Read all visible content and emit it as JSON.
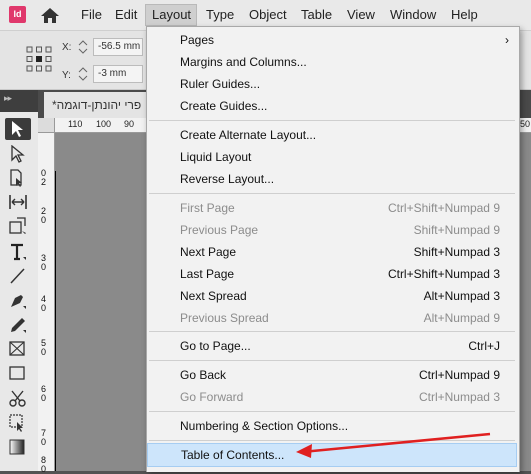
{
  "app": {
    "logo_text": "Id"
  },
  "menubar": {
    "items": [
      "File",
      "Edit",
      "Layout",
      "Type",
      "Object",
      "Table",
      "View",
      "Window",
      "Help"
    ],
    "active": "Layout"
  },
  "control_panel": {
    "x_label": "X:",
    "x_value": "-56.5 mm",
    "y_label": "Y:",
    "y_value": "-3 mm"
  },
  "tools_panel": {
    "collapse_glyph": "▸▸"
  },
  "document": {
    "tab_title": "פרי יהונתן-דוגמה*",
    "ruler_h": [
      "110",
      "100",
      "90",
      "50"
    ],
    "ruler_v": [
      "0\n2",
      "2\n0",
      "3\n0",
      "4\n0",
      "5\n0",
      "6\n0",
      "7\n0",
      "8\n0"
    ]
  },
  "layout_menu": {
    "items": [
      {
        "label": "Pages",
        "shortcut": "",
        "submenu": true,
        "enabled": true
      },
      {
        "label": "Margins and Columns...",
        "shortcut": "",
        "enabled": true
      },
      {
        "label": "Ruler Guides...",
        "shortcut": "",
        "enabled": true
      },
      {
        "label": "Create Guides...",
        "shortcut": "",
        "enabled": true
      },
      {
        "label": "Create Alternate Layout...",
        "shortcut": "",
        "enabled": true
      },
      {
        "label": "Liquid Layout",
        "shortcut": "",
        "enabled": true
      },
      {
        "label": "Reverse Layout...",
        "shortcut": "",
        "enabled": true
      },
      {
        "label": "First Page",
        "shortcut": "Ctrl+Shift+Numpad 9",
        "enabled": false
      },
      {
        "label": "Previous Page",
        "shortcut": "Shift+Numpad 9",
        "enabled": false
      },
      {
        "label": "Next Page",
        "shortcut": "Shift+Numpad 3",
        "enabled": true
      },
      {
        "label": "Last Page",
        "shortcut": "Ctrl+Shift+Numpad 3",
        "enabled": true
      },
      {
        "label": "Next Spread",
        "shortcut": "Alt+Numpad 3",
        "enabled": true
      },
      {
        "label": "Previous Spread",
        "shortcut": "Alt+Numpad 9",
        "enabled": false
      },
      {
        "label": "Go to Page...",
        "shortcut": "Ctrl+J",
        "enabled": true
      },
      {
        "label": "Go Back",
        "shortcut": "Ctrl+Numpad 9",
        "enabled": true
      },
      {
        "label": "Go Forward",
        "shortcut": "Ctrl+Numpad 3",
        "enabled": false
      },
      {
        "label": "Numbering & Section Options...",
        "shortcut": "",
        "enabled": true
      },
      {
        "label": "Table of Contents...",
        "shortcut": "",
        "enabled": true,
        "highlighted": true
      }
    ],
    "submenu_glyph": "›"
  },
  "colors": {
    "highlight": "#cde5fb",
    "annotation_arrow": "#e02020",
    "app_logo": "#e0386c"
  }
}
